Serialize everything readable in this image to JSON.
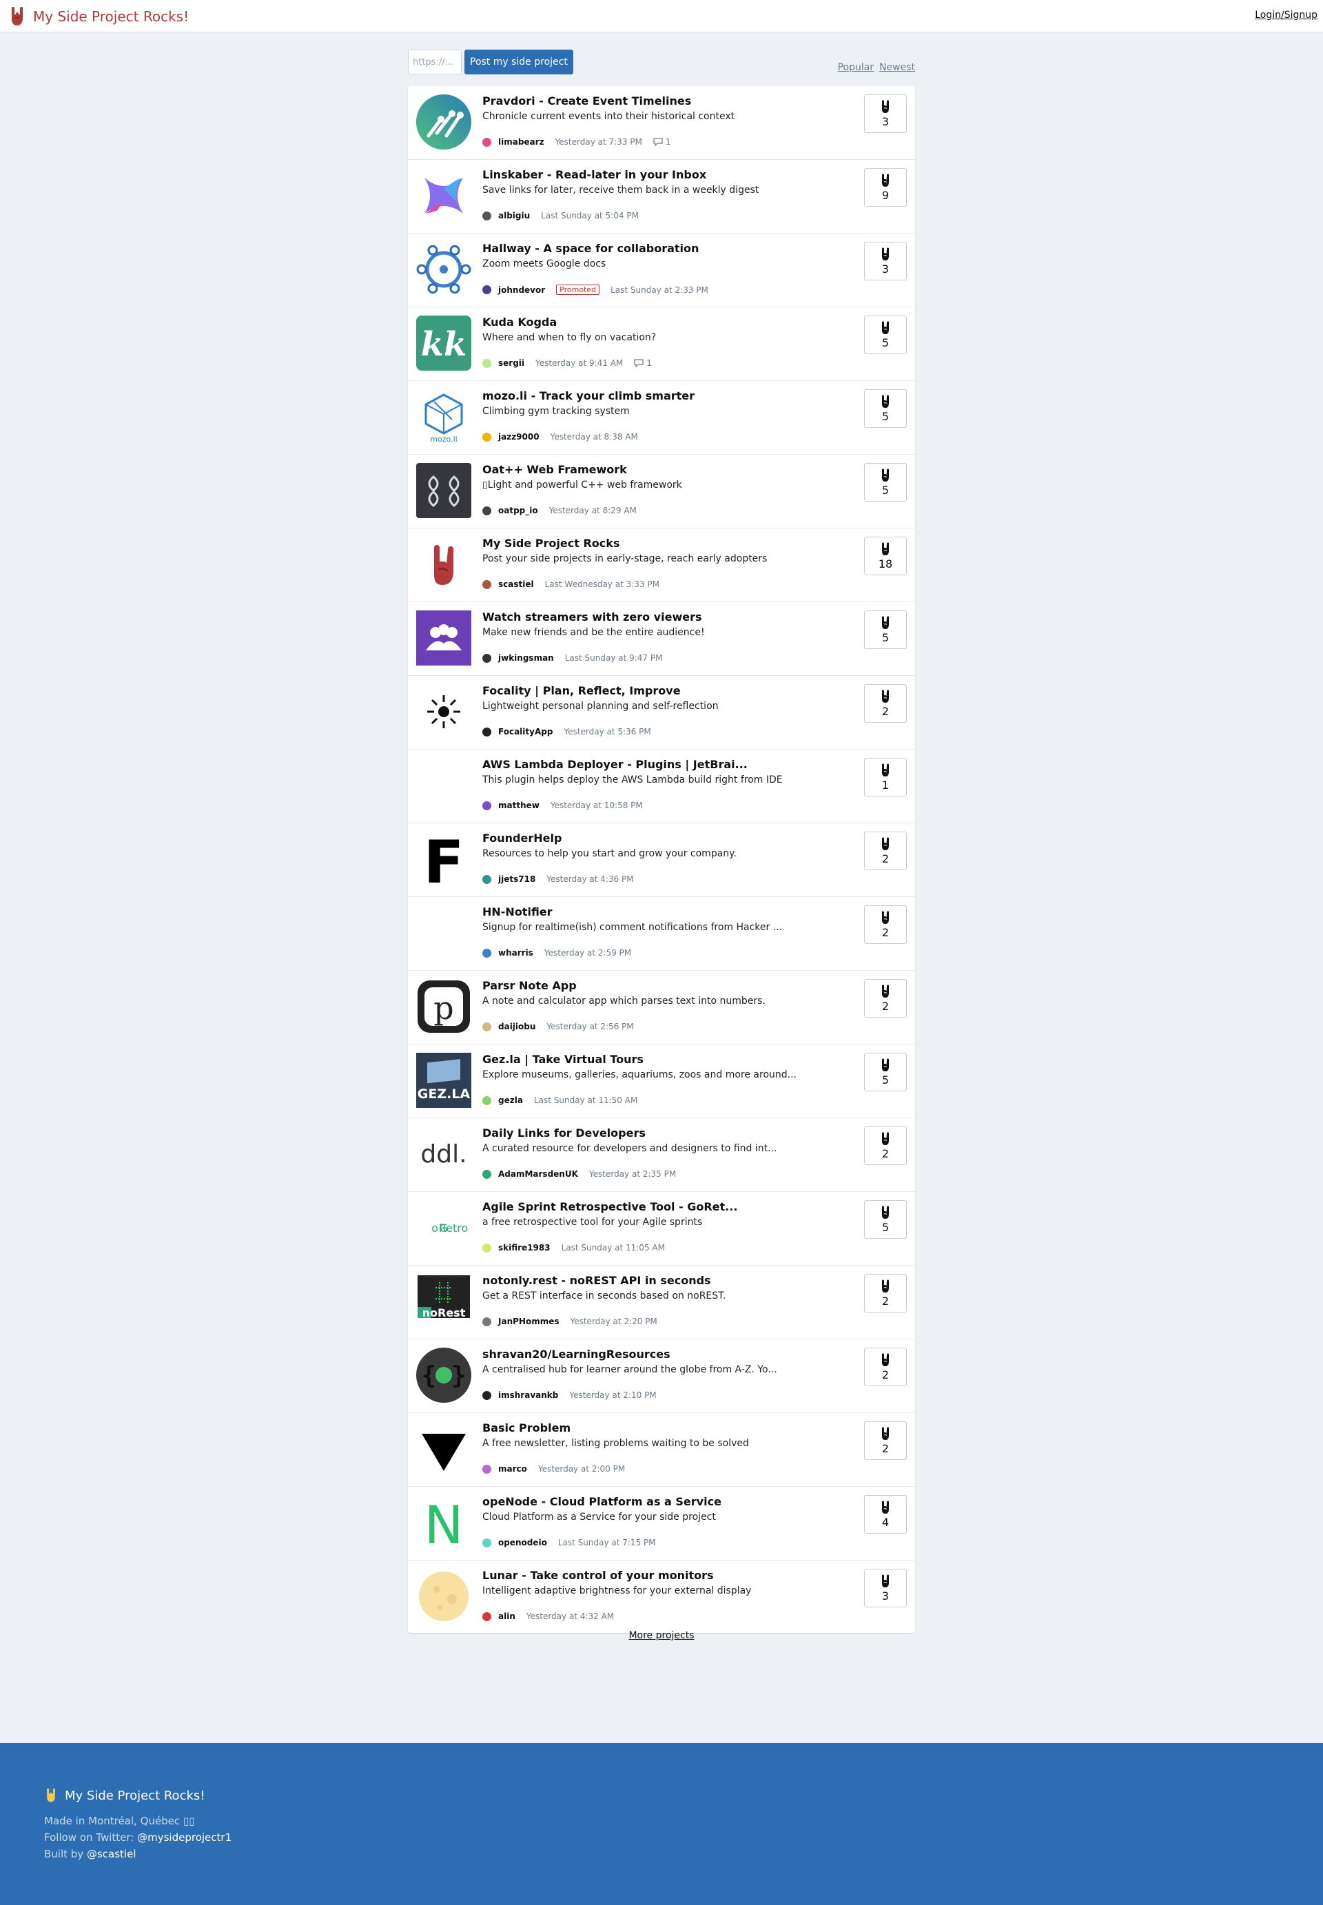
{
  "header": {
    "app_title": "My Side Project Rocks!",
    "login_label": "Login/Signup",
    "logo_icon": "rock-hand-icon"
  },
  "post_form": {
    "url_placeholder": "https://...",
    "submit_label": "Post my side project"
  },
  "sort": {
    "popular_label": "Popular",
    "newest_label": "Newest"
  },
  "colors": {
    "brand_red": "#b23a3a",
    "accent_blue": "#2d6db4",
    "background": "#edf1f5"
  },
  "projects": [
    {
      "title": "Pravdori - Create Event Timelines",
      "description": "Chronicle current events into their historical context",
      "user": "limabearz",
      "time": "Yesterday at 7:33 PM",
      "comments": "1",
      "votes": "3",
      "promoted": ""
    },
    {
      "title": "Linskaber - Read-later in your Inbox",
      "description": "Save links for later, receive them back in a weekly digest",
      "user": "albigiu",
      "time": "Last Sunday at 5:04 PM",
      "comments": "",
      "votes": "9",
      "promoted": ""
    },
    {
      "title": "Hallway - A space for collaboration",
      "description": "Zoom meets Google docs",
      "user": "johndevor",
      "time": "Last Sunday at 2:33 PM",
      "comments": "",
      "votes": "3",
      "promoted": "Promoted"
    },
    {
      "title": "Kuda Kogda",
      "description": "Where and when to fly on vacation?",
      "user": "sergii",
      "time": "Yesterday at 9:41 AM",
      "comments": "1",
      "votes": "5",
      "promoted": ""
    },
    {
      "title": "mozo.li - Track your climb smarter",
      "description": "Climbing gym tracking system",
      "user": "jazz9000",
      "time": "Yesterday at 8:38 AM",
      "comments": "",
      "votes": "5",
      "promoted": ""
    },
    {
      "title": "Oat++ Web Framework",
      "description": "▯Light and powerful C++ web framework",
      "user": "oatpp_io",
      "time": "Yesterday at 8:29 AM",
      "comments": "",
      "votes": "5",
      "promoted": ""
    },
    {
      "title": "My Side Project Rocks",
      "description": "Post your side projects in early-stage, reach early adopters",
      "user": "scastiel",
      "time": "Last Wednesday at 3:33 PM",
      "comments": "",
      "votes": "18",
      "promoted": ""
    },
    {
      "title": "Watch streamers with zero viewers",
      "description": "Make new friends and be the entire audience!",
      "user": "jwkingsman",
      "time": "Last Sunday at 9:47 PM",
      "comments": "",
      "votes": "5",
      "promoted": ""
    },
    {
      "title": "Focality | Plan, Reflect, Improve",
      "description": "Lightweight personal planning and self-reflection",
      "user": "FocalityApp",
      "time": "Yesterday at 5:36 PM",
      "comments": "",
      "votes": "2",
      "promoted": ""
    },
    {
      "title": "AWS Lambda Deployer - Plugins | JetBrai...",
      "description": "This plugin helps deploy the AWS Lambda build right from IDE",
      "user": "matthew",
      "time": "Yesterday at 10:58 PM",
      "comments": "",
      "votes": "1",
      "promoted": ""
    },
    {
      "title": "FounderHelp",
      "description": "Resources to help you start and grow your company.",
      "user": "jjets718",
      "time": "Yesterday at 4:36 PM",
      "comments": "",
      "votes": "2",
      "promoted": ""
    },
    {
      "title": "HN-Notifier",
      "description": "Signup for realtime(ish) comment notifications from Hacker ...",
      "user": "wharris",
      "time": "Yesterday at 2:59 PM",
      "comments": "",
      "votes": "2",
      "promoted": ""
    },
    {
      "title": "Parsr Note App",
      "description": "A note and calculator app which parses text into numbers.",
      "user": "daijiobu",
      "time": "Yesterday at 2:56 PM",
      "comments": "",
      "votes": "2",
      "promoted": ""
    },
    {
      "title": "Gez.la | Take Virtual Tours",
      "description": "Explore museums, galleries, aquariums, zoos and more around...",
      "user": "gezla",
      "time": "Last Sunday at 11:50 AM",
      "comments": "",
      "votes": "5",
      "promoted": ""
    },
    {
      "title": "Daily Links for Developers",
      "description": "A curated resource for developers and designers to find int...",
      "user": "AdamMarsdenUK",
      "time": "Yesterday at 2:35 PM",
      "comments": "",
      "votes": "2",
      "promoted": ""
    },
    {
      "title": "Agile Sprint Retrospective Tool - GoRet...",
      "description": "a free retrospective tool for your Agile sprints",
      "user": "skifire1983",
      "time": "Last Sunday at 11:05 AM",
      "comments": "",
      "votes": "5",
      "promoted": ""
    },
    {
      "title": "notonly.rest - noREST API in seconds",
      "description": "Get a REST interface in seconds based on noREST.",
      "user": "JanPHommes",
      "time": "Yesterday at 2:20 PM",
      "comments": "",
      "votes": "2",
      "promoted": ""
    },
    {
      "title": "shravan20/LearningResources",
      "description": "A centralised hub for learner around the globe from A-Z. Yo...",
      "user": "imshravankb",
      "time": "Yesterday at 2:10 PM",
      "comments": "",
      "votes": "2",
      "promoted": ""
    },
    {
      "title": "Basic Problem",
      "description": "A free newsletter, listing problems waiting to be solved",
      "user": "marco",
      "time": "Yesterday at 2:00 PM",
      "comments": "",
      "votes": "2",
      "promoted": ""
    },
    {
      "title": "opeNode - Cloud Platform as a Service",
      "description": "Cloud Platform as a Service for your side project",
      "user": "openodeio",
      "time": "Last Sunday at 7:15 PM",
      "comments": "",
      "votes": "4",
      "promoted": ""
    },
    {
      "title": "Lunar - Take control of your monitors",
      "description": "Intelligent adaptive brightness for your external display",
      "user": "alin",
      "time": "Yesterday at 4:32 AM",
      "comments": "",
      "votes": "3",
      "promoted": ""
    }
  ],
  "thumbnails": [
    {
      "icon": "pravdori-timeline-icon"
    },
    {
      "icon": "linskaber-bow-icon"
    },
    {
      "icon": "hallway-network-icon"
    },
    {
      "icon": "kuda-kogda-kk-icon",
      "text": "kk"
    },
    {
      "icon": "mozo-cube-icon",
      "text": "mozo.li"
    },
    {
      "icon": "oatpp-leaf-icon"
    },
    {
      "icon": "rock-hand-icon"
    },
    {
      "icon": "streamers-people-icon"
    },
    {
      "icon": "focality-sun-icon"
    },
    {
      "icon": "blank-thumbnail"
    },
    {
      "icon": "founderhelp-f-icon",
      "text": "F"
    },
    {
      "icon": "blank-thumbnail"
    },
    {
      "icon": "parsr-p-icon",
      "text": "p"
    },
    {
      "icon": "gezla-flag-icon",
      "text": "GEZ.LA"
    },
    {
      "icon": "ddl-text-icon",
      "text": "ddl."
    },
    {
      "icon": "goretro-logo-icon",
      "text": "GoRetro"
    },
    {
      "icon": "norest-terminal-icon",
      "text": "noRest"
    },
    {
      "icon": "learning-braces-icon",
      "text": "{ }"
    },
    {
      "icon": "triangle-down-icon"
    },
    {
      "icon": "openode-n-icon",
      "text": "N"
    },
    {
      "icon": "lunar-moon-icon"
    }
  ],
  "more_label": "More projects",
  "footer": {
    "title": "My Side Project Rocks!",
    "made_in": "Made in Montréal, Québec ▯▯",
    "follow_prefix": "Follow on Twitter:",
    "twitter_handle": "@mysideprojectr1",
    "built_prefix": "Built by",
    "built_handle": "@scastiel"
  }
}
